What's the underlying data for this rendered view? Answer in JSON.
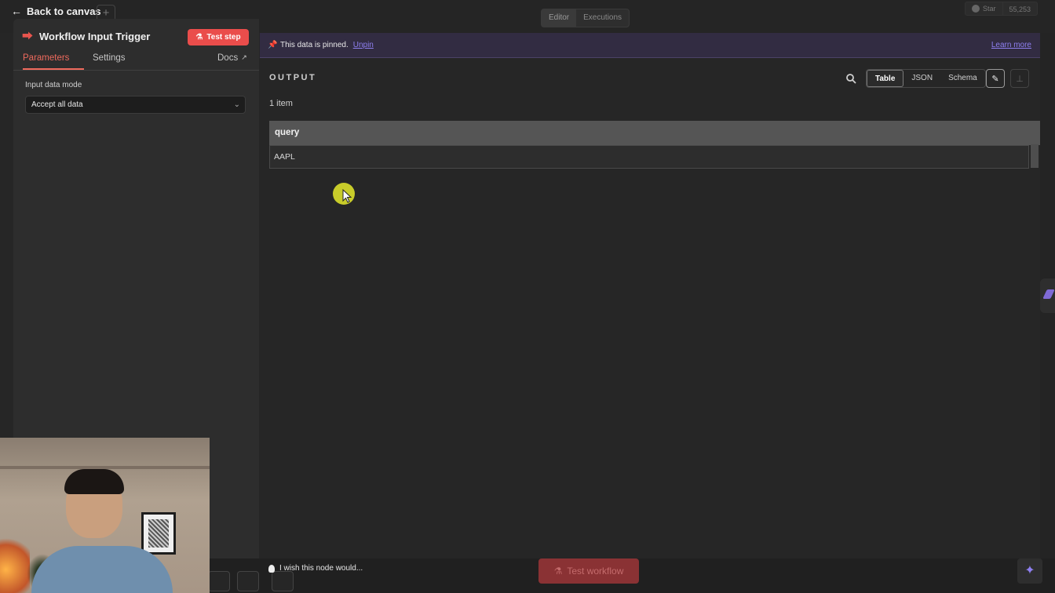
{
  "header": {
    "back_label": "Back to canvas",
    "add_label": "+",
    "view_tabs": [
      "Editor",
      "Executions"
    ],
    "github": {
      "star_label": "Star",
      "star_count": "55,253"
    }
  },
  "node": {
    "title": "Workflow Input Trigger",
    "test_step_label": "Test step",
    "tabs": {
      "parameters": "Parameters",
      "settings": "Settings",
      "docs": "Docs"
    },
    "input_mode_label": "Input data mode",
    "input_mode_value": "Accept all data"
  },
  "output": {
    "pinned_text": "This data is pinned.",
    "unpin_label": "Unpin",
    "learn_more_label": "Learn more",
    "title": "OUTPUT",
    "view_modes": [
      "Table",
      "JSON",
      "Schema"
    ],
    "active_mode": "Table",
    "item_count": "1 item",
    "table": {
      "columns": [
        "query"
      ],
      "rows": [
        [
          "AAPL"
        ]
      ]
    }
  },
  "footer": {
    "feedback_label": "I wish this node would...",
    "test_workflow_label": "Test workflow"
  },
  "colors": {
    "accent_red": "#ea4d4b",
    "pinned_purple": "#8e7ff0",
    "cursor_highlight": "#c8cc2a"
  }
}
